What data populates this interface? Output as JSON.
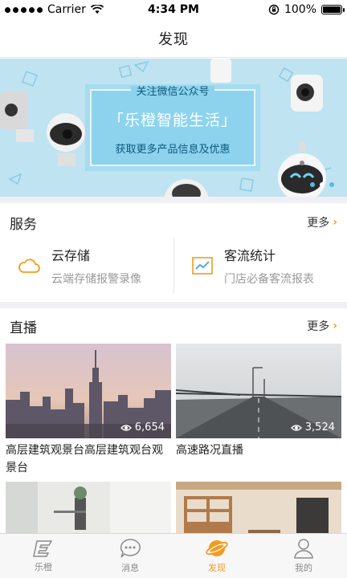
{
  "status_bar": {
    "carrier": "Carrier",
    "time": "4:34 PM",
    "battery": "100%"
  },
  "nav": {
    "title": "发现"
  },
  "banner": {
    "line1": "关注微信公众号",
    "line2": "「乐橙智能生活」",
    "line3": "获取更多产品信息及优惠"
  },
  "services": {
    "title": "服务",
    "more": "更多",
    "items": [
      {
        "icon": "cloud-icon",
        "title": "云存储",
        "subtitle": "云端存储报警录像"
      },
      {
        "icon": "chart-icon",
        "title": "客流统计",
        "subtitle": "门店必备客流报表"
      }
    ]
  },
  "live": {
    "title": "直播",
    "more": "更多",
    "items": [
      {
        "views": "6,654",
        "title": "高层建筑观景台高层建筑观台观景台"
      },
      {
        "views": "3,524",
        "title": "高速路况直播"
      },
      {
        "views": "",
        "title": ""
      },
      {
        "views": "",
        "title": ""
      }
    ]
  },
  "tabs": [
    {
      "label": "乐橙",
      "icon": "lechange-logo-icon"
    },
    {
      "label": "消息",
      "icon": "message-icon"
    },
    {
      "label": "发现",
      "icon": "planet-icon",
      "active": true
    },
    {
      "label": "我的",
      "icon": "user-icon"
    }
  ],
  "colors": {
    "accent": "#f39b1e",
    "banner_bg": "#bfe3f1",
    "banner_card": "#8dd3ee"
  }
}
